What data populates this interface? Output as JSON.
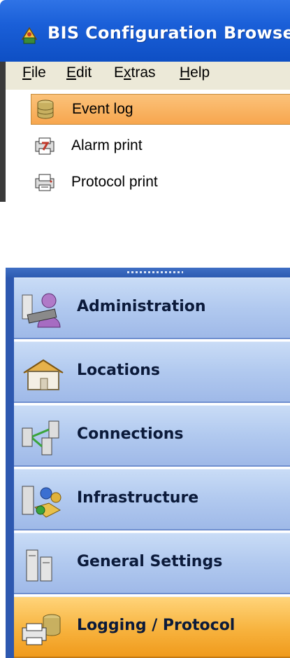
{
  "window": {
    "title": "BIS Configuration Browse"
  },
  "menu": [
    {
      "label": "File",
      "accel": "F"
    },
    {
      "label": "Edit",
      "accel": "E"
    },
    {
      "label": "Extras",
      "accel": "x"
    },
    {
      "label": "Help",
      "accel": "H"
    }
  ],
  "list": {
    "items": [
      {
        "label": "Event log",
        "icon": "database-icon",
        "selected": true
      },
      {
        "label": "Alarm print",
        "icon": "alarm-printer-icon",
        "selected": false
      },
      {
        "label": "Protocol print",
        "icon": "protocol-printer-icon",
        "selected": false
      }
    ]
  },
  "nav": {
    "items": [
      {
        "label": "Administration",
        "icon": "administration-icon",
        "active": false
      },
      {
        "label": "Locations",
        "icon": "house-icon",
        "active": false
      },
      {
        "label": "Connections",
        "icon": "connections-icon",
        "active": false
      },
      {
        "label": "Infrastructure",
        "icon": "infrastructure-icon",
        "active": false
      },
      {
        "label": "General Settings",
        "icon": "settings-icon",
        "active": false
      },
      {
        "label": "Logging / Protocol",
        "icon": "logging-icon",
        "active": true
      }
    ]
  },
  "colors": {
    "titlebar": "#1a5fd8",
    "nav_bg": "#b1c9ef",
    "active_bg": "#f7b33e",
    "selected_bg": "#f9b563"
  }
}
